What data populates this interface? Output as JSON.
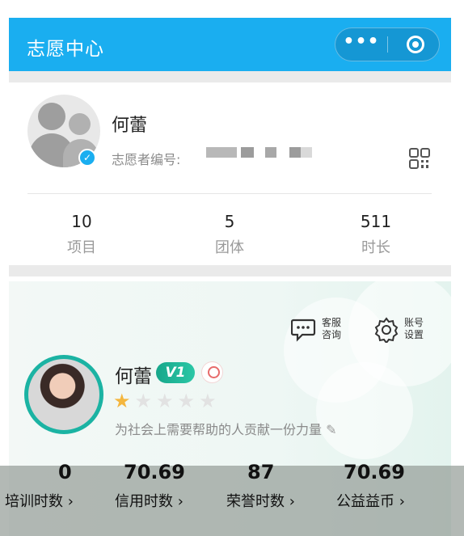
{
  "nav": {
    "title": "志愿中心",
    "more_label": "•••"
  },
  "profile": {
    "name": "何蕾",
    "id_label": "志愿者编号:"
  },
  "stats": [
    {
      "value": "10",
      "label": "项目"
    },
    {
      "value": "5",
      "label": "团体"
    },
    {
      "value": "511",
      "label": "时长"
    }
  ],
  "tools": [
    {
      "line1": "客服",
      "line2": "咨询",
      "icon": "chat-icon"
    },
    {
      "line1": "账号",
      "line2": "设置",
      "icon": "gear-icon"
    }
  ],
  "volunteer": {
    "name": "何蕾",
    "level": "V1",
    "stars_filled": 1,
    "stars_total": 5,
    "motto": "为社会上需要帮助的人贡献一份力量"
  },
  "metrics": [
    {
      "value": "0",
      "label": "培训时数 ›"
    },
    {
      "value": "70.69",
      "label": "信用时数 ›"
    },
    {
      "value": "87",
      "label": "荣誉时数 ›"
    },
    {
      "value": "70.69",
      "label": "公益益币 ›"
    }
  ],
  "colors": {
    "nav_blue": "#1aaef0",
    "badge_green": "#17a78b",
    "star_gold": "#f4b63e"
  }
}
